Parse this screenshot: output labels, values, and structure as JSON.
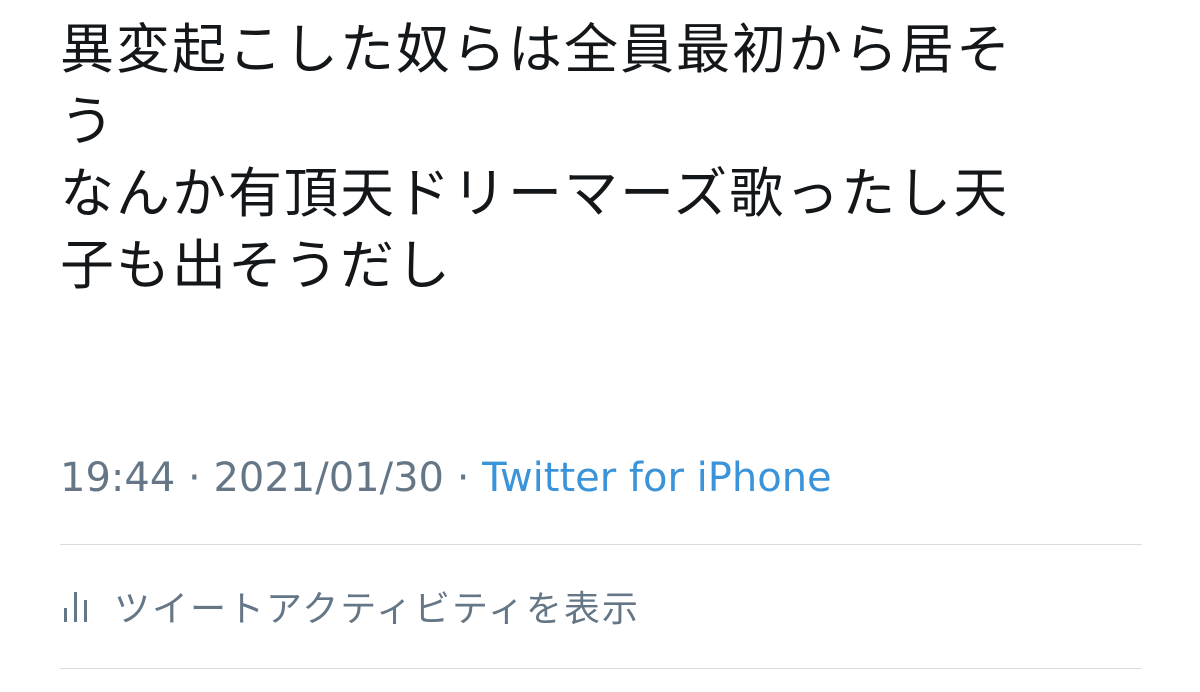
{
  "tweet": {
    "lines": [
      "異変起こした奴らは全員最初から居そ",
      "う",
      "なんか有頂天ドリーマーズ歌ったし天",
      "子も出そうだし"
    ]
  },
  "meta": {
    "time": "19:44",
    "separator": "·",
    "date": "2021/01/30",
    "source": "Twitter for iPhone"
  },
  "activity": {
    "label": "ツイートアクティビティを表示",
    "icon": "bar-chart-icon"
  },
  "colors": {
    "text": "#14171a",
    "secondary": "#657786",
    "link": "#3b94d9",
    "divider": "#d7dde2"
  }
}
